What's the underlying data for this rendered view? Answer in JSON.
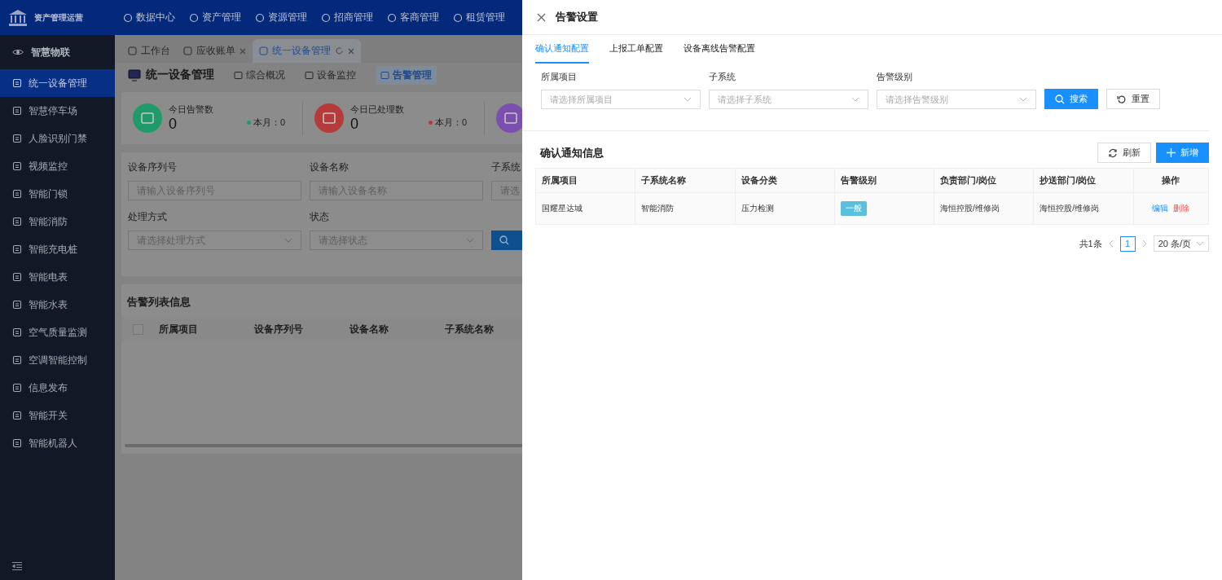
{
  "app": {
    "logo_text": "资产管理运营",
    "top_menu": [
      {
        "label": "数据中心"
      },
      {
        "label": "资产管理"
      },
      {
        "label": "资源管理"
      },
      {
        "label": "招商管理"
      },
      {
        "label": "客商管理"
      },
      {
        "label": "租赁管理"
      }
    ],
    "sidebar": {
      "title": "智慧物联",
      "items": [
        {
          "label": "统一设备管理",
          "selected": true
        },
        {
          "label": "智慧停车场",
          "selected": false
        },
        {
          "label": "人脸识别门禁",
          "selected": false
        },
        {
          "label": "视频监控",
          "selected": false
        },
        {
          "label": "智能门锁",
          "selected": false
        },
        {
          "label": "智能消防",
          "selected": false
        },
        {
          "label": "智能充电桩",
          "selected": false
        },
        {
          "label": "智能电表",
          "selected": false
        },
        {
          "label": "智能水表",
          "selected": false
        },
        {
          "label": "空气质量监测",
          "selected": false
        },
        {
          "label": "空调智能控制",
          "selected": false
        },
        {
          "label": "信息发布",
          "selected": false
        },
        {
          "label": "智能开关",
          "selected": false
        },
        {
          "label": "智能机器人",
          "selected": false
        }
      ]
    },
    "page_tabs": [
      {
        "label": "工作台",
        "selected": false,
        "closable": false
      },
      {
        "label": "应收账单",
        "selected": false,
        "closable": true
      },
      {
        "label": "统一设备管理",
        "selected": true,
        "closable": true
      }
    ],
    "page": {
      "title": "统一设备管理",
      "subnav": [
        {
          "label": "综合概况",
          "selected": false
        },
        {
          "label": "设备监控",
          "selected": false
        },
        {
          "label": "告警管理",
          "selected": true
        }
      ],
      "stats": [
        {
          "label": "今日告警数",
          "value": "0",
          "month": "本月：0",
          "color": "#1f9a6a"
        },
        {
          "label": "今日已处理数",
          "value": "0",
          "month": "本月：0",
          "color": "#b53b3b"
        },
        {
          "color": "#7a4fae"
        }
      ],
      "filters": [
        {
          "label": "设备序列号",
          "placeholder": "请输入设备序列号",
          "kind": "input"
        },
        {
          "label": "设备名称",
          "placeholder": "请输入设备名称",
          "kind": "input"
        },
        {
          "label": "子系统",
          "placeholder": "请选",
          "kind": "input"
        },
        {
          "label": "处理方式",
          "placeholder": "请选择处理方式",
          "kind": "select"
        },
        {
          "label": "状态",
          "placeholder": "请选择状态",
          "kind": "select"
        }
      ],
      "list": {
        "title": "告警列表信息",
        "all_checked": false,
        "columns": [
          "所属项目",
          "设备序列号",
          "设备名称",
          "子系统名称"
        ]
      }
    }
  },
  "drawer": {
    "title": "告警设置",
    "tabs": [
      {
        "label": "确认通知配置",
        "selected": true
      },
      {
        "label": "上报工单配置",
        "selected": false
      },
      {
        "label": "设备离线告警配置",
        "selected": false
      }
    ],
    "filters": [
      {
        "label": "所属项目",
        "placeholder": "请选择所属项目"
      },
      {
        "label": "子系统",
        "placeholder": "请选择子系统"
      },
      {
        "label": "告警级别",
        "placeholder": "请选择告警级别"
      }
    ],
    "search_button": "搜索",
    "reset_button": "重置",
    "section_title": "确认通知信息",
    "refresh_button": "刷新",
    "add_button": "新增",
    "columns": [
      "所属项目",
      "子系统名称",
      "设备分类",
      "告警级别",
      "负责部门/岗位",
      "抄送部门/岗位",
      "操作"
    ],
    "rows": [
      {
        "project": "国耀星达城",
        "subsystem": "智能消防",
        "category": "压力检测",
        "level": {
          "text": "一般",
          "color": "#5bc0de"
        },
        "owner": "海恒控股/维修岗",
        "cc": "海恒控股/维修岗",
        "actions": [
          {
            "label": "编辑",
            "kind": "edit"
          },
          {
            "label": "删除",
            "kind": "delete"
          }
        ]
      }
    ],
    "pagination": {
      "total": "共1条",
      "pages": [
        {
          "label": "1",
          "selected": true
        }
      ],
      "page_size": "20 条/页"
    }
  }
}
